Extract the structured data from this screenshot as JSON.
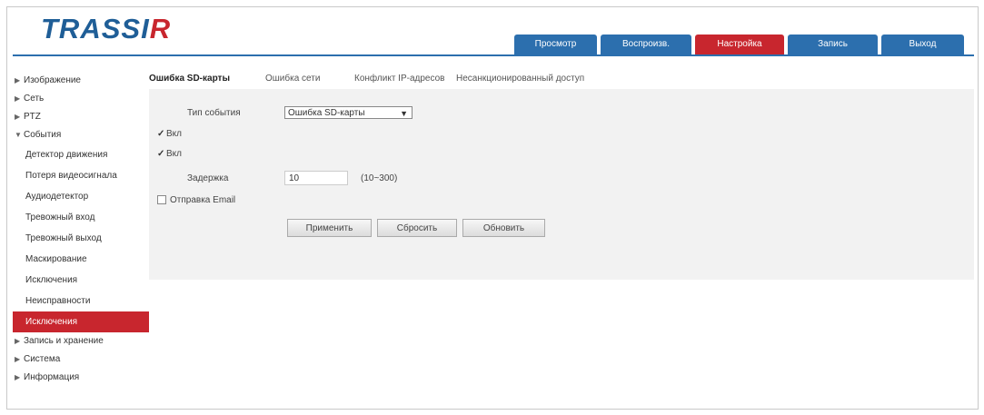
{
  "app": {
    "logo_main": "TRASSI",
    "logo_accent": "R"
  },
  "nav": [
    {
      "label": "Просмотр",
      "active": false
    },
    {
      "label": "Воспроизв.",
      "active": false
    },
    {
      "label": "Настройка",
      "active": true
    },
    {
      "label": "Запись",
      "active": false
    },
    {
      "label": "Выход",
      "active": false
    }
  ],
  "sidebar": [
    {
      "label": "Изображение",
      "level": 0,
      "expanded": false
    },
    {
      "label": "Сеть",
      "level": 0,
      "expanded": false
    },
    {
      "label": "PTZ",
      "level": 0,
      "expanded": false
    },
    {
      "label": "События",
      "level": 0,
      "expanded": true
    },
    {
      "label": "Детектор движения",
      "level": 1
    },
    {
      "label": "Потеря видеосигнала",
      "level": 1
    },
    {
      "label": "Аудиодетектор",
      "level": 1
    },
    {
      "label": "Тревожный вход",
      "level": 1
    },
    {
      "label": "Тревожный выход",
      "level": 1
    },
    {
      "label": "Маскирование",
      "level": 1
    },
    {
      "label": "Исключения",
      "level": 1
    },
    {
      "label": "Неисправности",
      "level": 1
    },
    {
      "label": "Исключения",
      "level": 1,
      "active": true
    },
    {
      "label": "Запись и хранение",
      "level": 0,
      "expanded": false
    },
    {
      "label": "Система",
      "level": 0,
      "expanded": false
    },
    {
      "label": "Информация",
      "level": 0,
      "expanded": false
    }
  ],
  "tabs": [
    {
      "label": "Ошибка SD-карты",
      "active": true
    },
    {
      "label": "Ошибка сети",
      "active": false
    },
    {
      "label": "Конфликт IP-адресов",
      "active": false
    },
    {
      "label": "Несанкционированный доступ",
      "active": false
    }
  ],
  "form": {
    "type_label": "Тип события",
    "type_value": "Ошибка SD-карты",
    "check1_label": "Вкл",
    "check2_label": "Вкл",
    "delay_label": "Задержка",
    "delay_value": "10",
    "delay_range": "(10~300)",
    "email_label": "Отправка Email",
    "buttons": {
      "apply": "Применить",
      "reset": "Сбросить",
      "refresh": "Обновить"
    }
  },
  "colors": {
    "brand_blue": "#2c6fae",
    "accent_red": "#c8262e"
  }
}
